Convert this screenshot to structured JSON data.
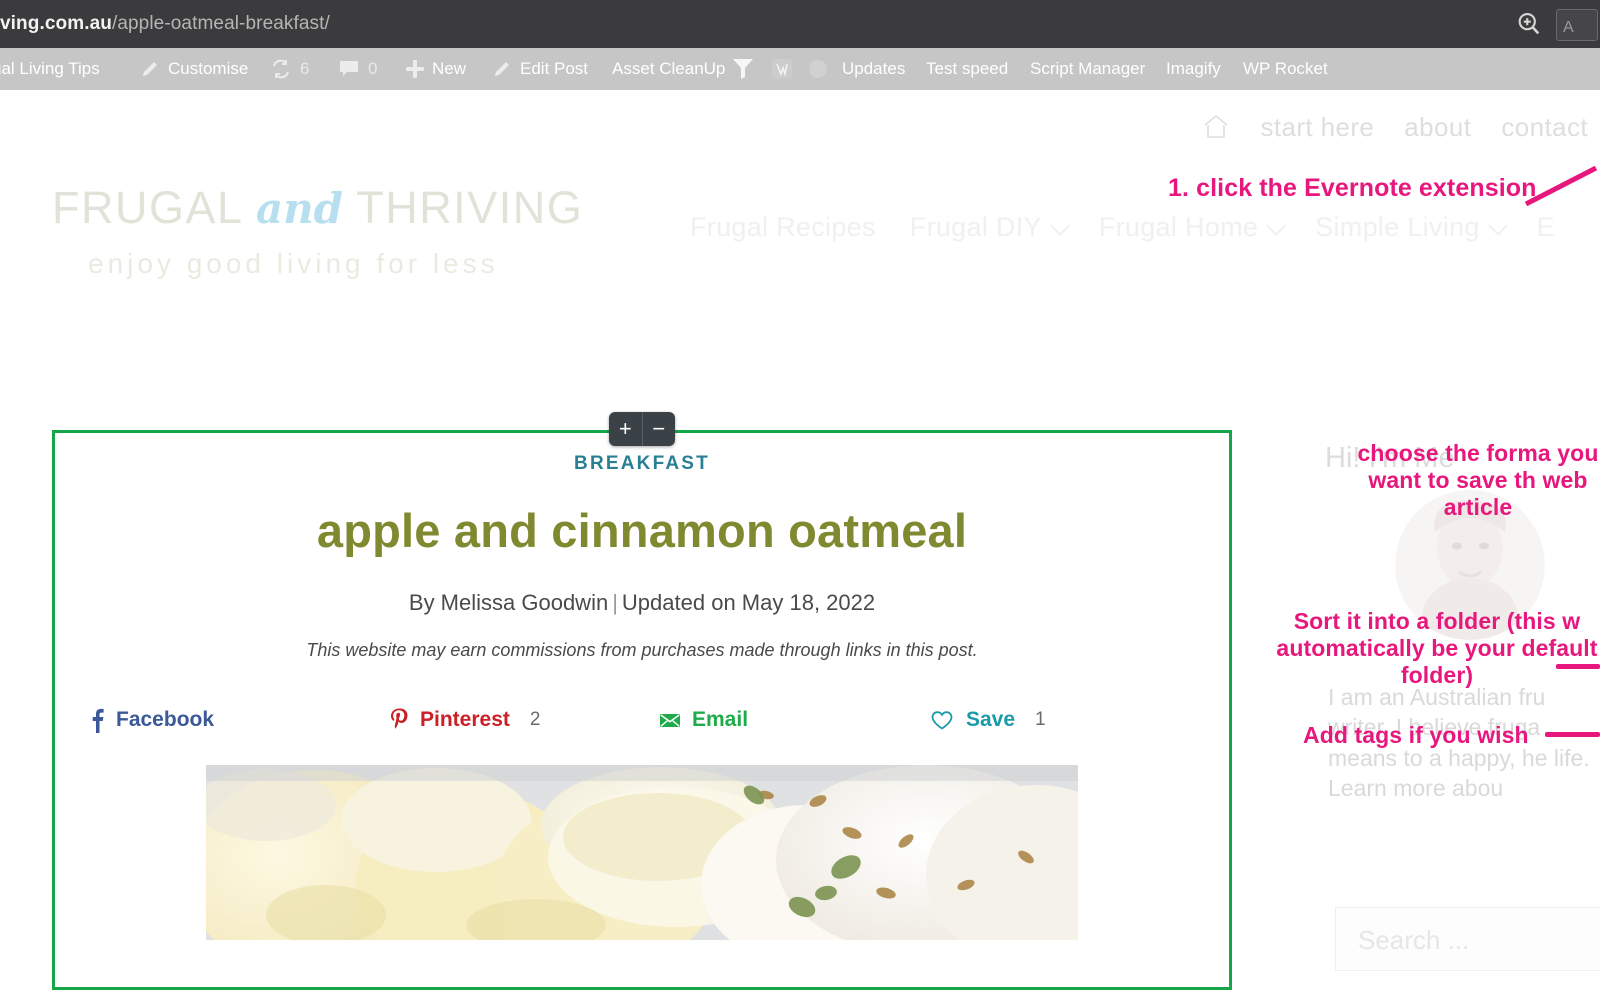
{
  "browser": {
    "url_host": "ving.com.au",
    "url_path": "/apple-oatmeal-breakfast/",
    "zoom_icon": "magnifier-plus-icon",
    "extension_icon": "evernote-extension-icon"
  },
  "admin_bar": {
    "items": [
      {
        "label": "gal Living Tips",
        "icon": null
      },
      {
        "label": "Customise",
        "icon": "pencil-icon"
      },
      {
        "label": "6",
        "icon": "updates-icon"
      },
      {
        "label": "0",
        "icon": "comment-bubble-icon"
      },
      {
        "label": "New",
        "icon": "plus-icon"
      },
      {
        "label": "Edit Post",
        "icon": "pencil-icon"
      },
      {
        "label": "Asset CleanUp",
        "icon": null
      },
      {
        "label": "",
        "icon": "funnel-icon"
      },
      {
        "label": "",
        "icon": "wp-plugin-icon"
      },
      {
        "label": "",
        "icon": "circle-icon"
      },
      {
        "label": "Updates",
        "icon": null
      },
      {
        "label": "Test speed",
        "icon": null
      },
      {
        "label": "Script Manager",
        "icon": null
      },
      {
        "label": "Imagify",
        "icon": null
      },
      {
        "label": "WP Rocket",
        "icon": null
      }
    ]
  },
  "utility_nav": {
    "home_icon": "home-icon",
    "items": [
      "start here",
      "about",
      "contact"
    ]
  },
  "logo": {
    "word1": "FRUGAL",
    "word_and": "and",
    "word2": "THRIVING",
    "tagline": "enjoy good living for less"
  },
  "main_nav": {
    "items": [
      {
        "label": "Frugal Recipes",
        "has_caret": false
      },
      {
        "label": "Frugal DIY",
        "has_caret": true
      },
      {
        "label": "Frugal Home",
        "has_caret": true
      },
      {
        "label": "Simple Living",
        "has_caret": true
      },
      {
        "label": "E",
        "has_caret": false
      }
    ]
  },
  "clipper": {
    "plus_label": "+",
    "minus_label": "−",
    "selection_color": "#16a64a"
  },
  "article": {
    "category": "BREAKFAST",
    "title": "apple and cinnamon oatmeal",
    "byline_author": "By Melissa Goodwin",
    "byline_separator": "|",
    "byline_updated": "Updated on May 18, 2022",
    "disclaimer": "This website may earn commissions from purchases made through links in this post.",
    "hero_image_alt": "bowl of oatmeal with banana slices and seeds"
  },
  "share": {
    "buttons": [
      {
        "name": "facebook",
        "label": "Facebook",
        "count": "",
        "color": "#3b5998",
        "icon": "facebook-icon"
      },
      {
        "name": "pinterest",
        "label": "Pinterest",
        "count": "2",
        "color": "#cb2027",
        "icon": "pinterest-icon"
      },
      {
        "name": "email",
        "label": "Email",
        "count": "",
        "color": "#1eac4b",
        "icon": "email-icon"
      },
      {
        "name": "save",
        "label": "Save",
        "count": "1",
        "color": "#1b9aaa",
        "icon": "heart-icon"
      }
    ]
  },
  "sidebar": {
    "greeting": "Hi! I'm Me",
    "avatar": "author-photo",
    "bio": "I am an Australian fru writer. I believe fruga means to a happy, he life. Learn more abou",
    "search_placeholder": "Search ..."
  },
  "annotations": {
    "step1": "1. click the Evernote extension",
    "step2": "choose the forma you want to save th web article",
    "step3": "Sort it into a folder (this w automatically be your default folder)",
    "step4": "Add tags if you wish",
    "color": "#e8177d"
  }
}
